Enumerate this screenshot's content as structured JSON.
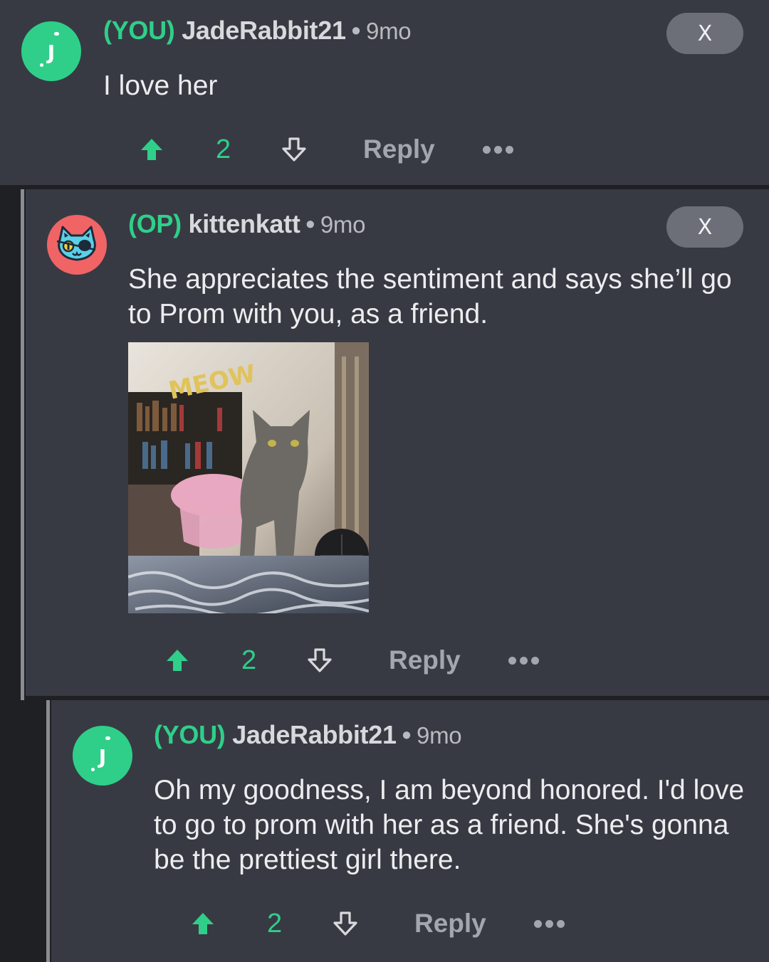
{
  "comments": [
    {
      "tag": "(YOU)",
      "username": "JadeRabbit21",
      "age": "9mo",
      "avatar_letter": "J",
      "close_label": "X",
      "text": "I love her",
      "votes": "2",
      "reply_label": "Reply"
    },
    {
      "tag": "(OP)",
      "username": "kittenkatt",
      "age": "9mo",
      "avatar": "cat-face-icon",
      "close_label": "X",
      "text": "She appreciates the sentiment and says she’ll go to Prom with you, as a friend.",
      "image_text": "MEOW",
      "votes": "2",
      "reply_label": "Reply"
    },
    {
      "tag": "(YOU)",
      "username": "JadeRabbit21",
      "age": "9mo",
      "avatar_letter": "J",
      "text": "Oh my goodness, I am beyond honored. I'd love to go to prom with her as a friend. She's gonna be the prettiest girl there.",
      "votes": "2",
      "reply_label": "Reply"
    }
  ],
  "separator": "•",
  "colors": {
    "accent_green": "#2fcf8a",
    "card_background": "#383a43",
    "page_background": "#1f2024",
    "op_avatar": "#f06466"
  }
}
